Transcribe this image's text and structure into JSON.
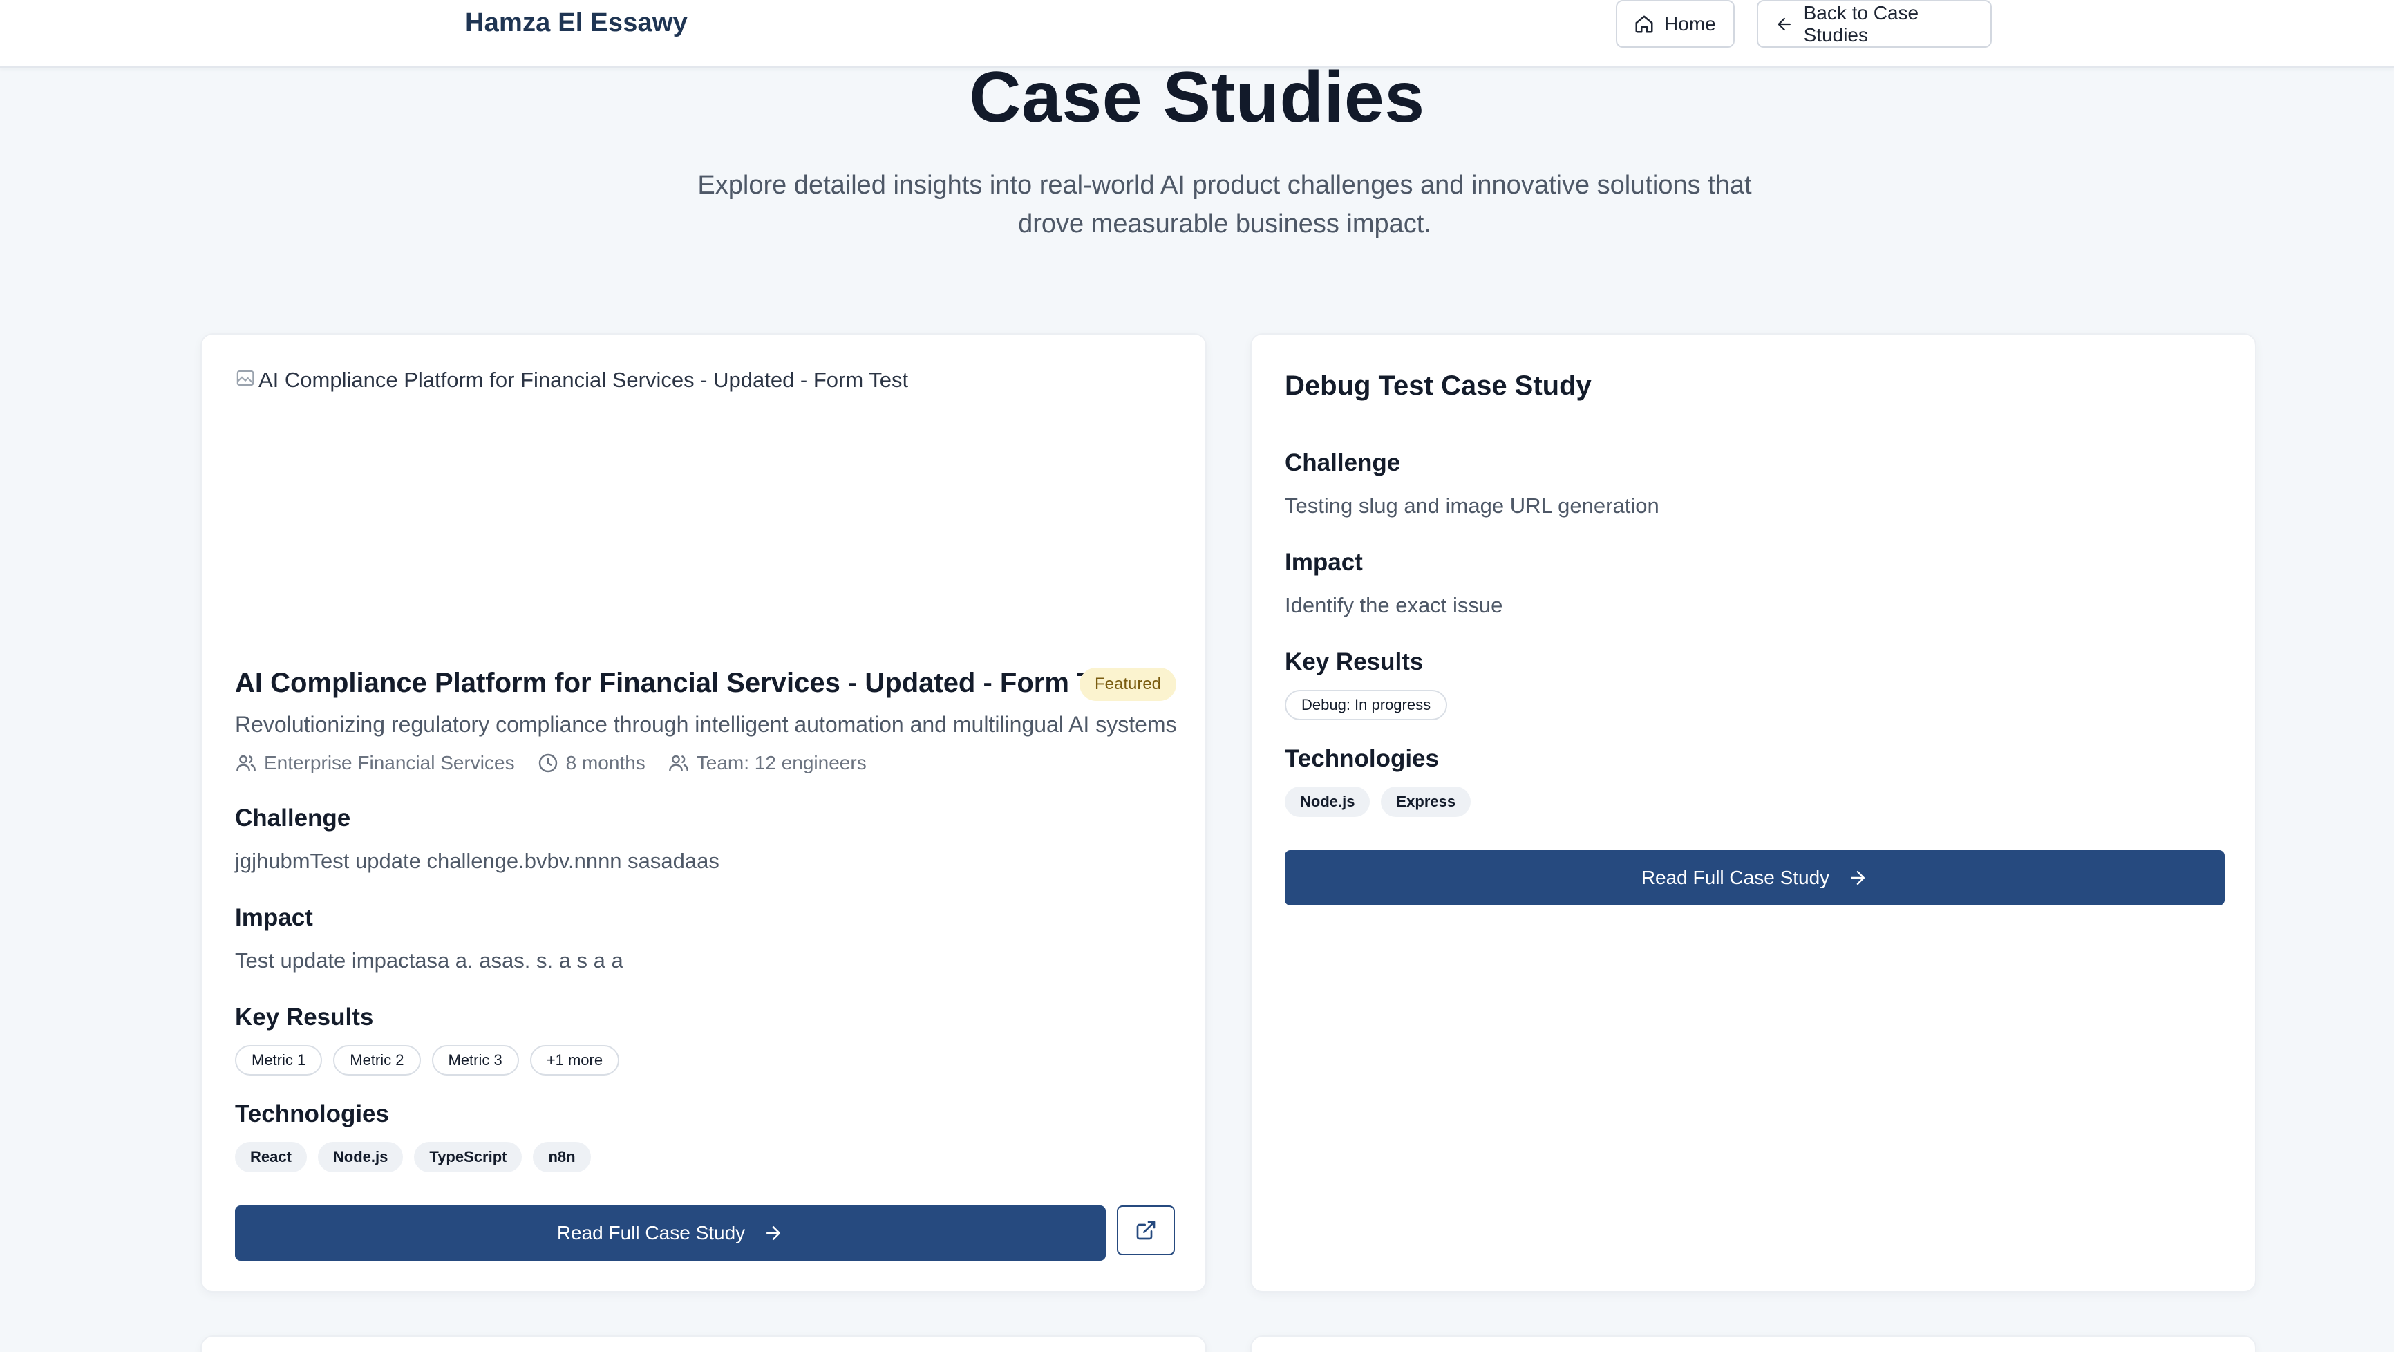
{
  "header": {
    "brand": "Hamza El Essawy",
    "home_label": "Home",
    "back_label": "Back to Case Studies"
  },
  "hero": {
    "title": "Case Studies",
    "subtitle": "Explore detailed insights into real-world AI product challenges and innovative solutions that drove measurable business impact."
  },
  "cards": [
    {
      "image_alt": "AI Compliance Platform for Financial Services - Updated - Form Test",
      "title": "AI Compliance Platform for Financial Services - Updated - Form Test",
      "badge": "Featured",
      "description": "Revolutionizing regulatory compliance through intelligent automation and multilingual AI systems",
      "meta": {
        "client": "Enterprise Financial Services",
        "duration": "8 months",
        "team": "Team: 12 engineers"
      },
      "challenge_heading": "Challenge",
      "challenge": "jgjhubmTest update challenge.bvbv.nnnn sasadaas",
      "impact_heading": "Impact",
      "impact": "Test update impactasa a. asas. s. a s a a",
      "results_heading": "Key Results",
      "results": [
        "Metric 1",
        "Metric 2",
        "Metric 3",
        "+1 more"
      ],
      "tech_heading": "Technologies",
      "technologies": [
        "React",
        "Node.js",
        "TypeScript",
        "n8n"
      ],
      "cta": "Read Full Case Study"
    },
    {
      "title": "Debug Test Case Study",
      "challenge_heading": "Challenge",
      "challenge": "Testing slug and image URL generation",
      "impact_heading": "Impact",
      "impact": "Identify the exact issue",
      "results_heading": "Key Results",
      "results": [
        "Debug: In progress"
      ],
      "tech_heading": "Technologies",
      "technologies": [
        "Node.js",
        "Express"
      ],
      "cta": "Read Full Case Study"
    }
  ],
  "colors": {
    "primary": "#264a7f",
    "badge_bg": "#fbf3cf",
    "badge_text": "#7a5c10",
    "background": "#f4f7fa"
  }
}
